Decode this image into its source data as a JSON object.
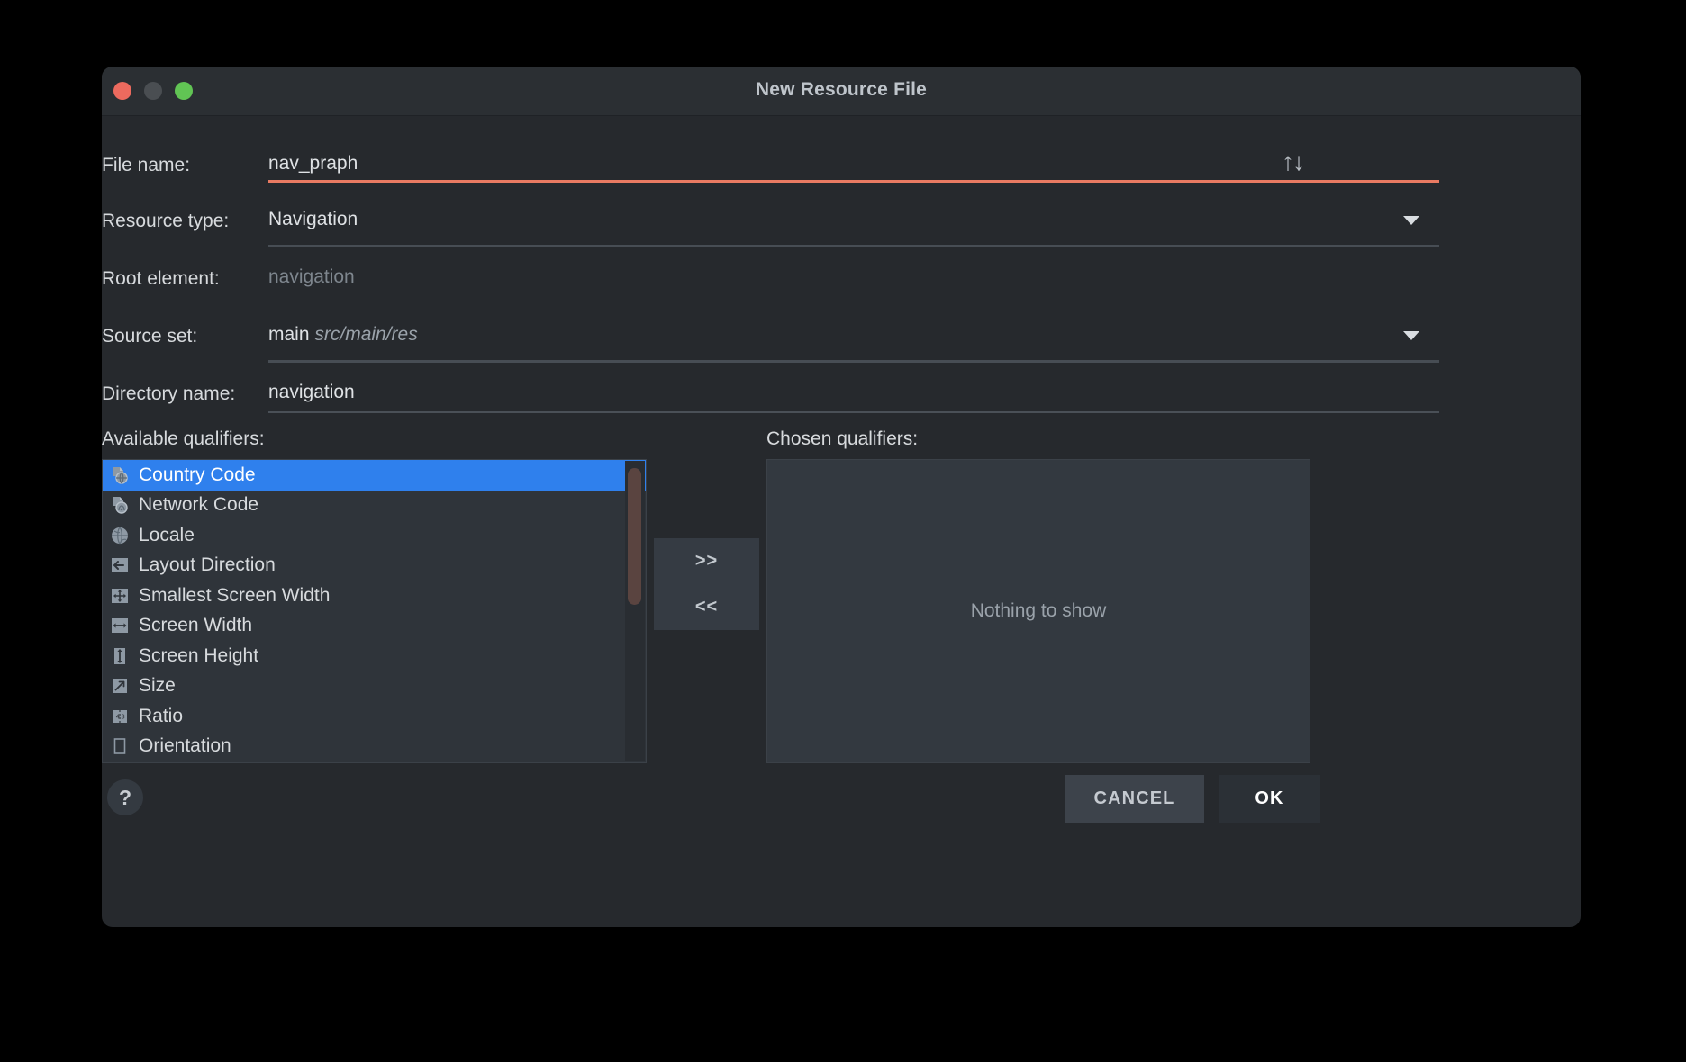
{
  "window": {
    "title": "New Resource File",
    "traffic_lights": [
      "close",
      "minimize",
      "maximize"
    ]
  },
  "form": {
    "file_name": {
      "label": "File name:",
      "value": "nav_praph",
      "accent_color": "#e87a62"
    },
    "resource_type": {
      "label": "Resource type:",
      "value": "Navigation"
    },
    "root_element": {
      "label": "Root element:",
      "value": "navigation",
      "is_placeholder": true
    },
    "source_set": {
      "label": "Source set:",
      "value": "main",
      "path": "src/main/res"
    },
    "directory_name": {
      "label": "Directory name:",
      "value": "navigation"
    },
    "sort_icon": "↑↓"
  },
  "qualifiers": {
    "available_label": "Available qualifiers:",
    "chosen_label": "Chosen qualifiers:",
    "available_items": [
      {
        "label": "Country Code",
        "icon": "country-code-icon",
        "selected": true
      },
      {
        "label": "Network Code",
        "icon": "network-code-icon",
        "selected": false
      },
      {
        "label": "Locale",
        "icon": "locale-globe-icon",
        "selected": false
      },
      {
        "label": "Layout Direction",
        "icon": "layout-direction-icon",
        "selected": false
      },
      {
        "label": "Smallest Screen Width",
        "icon": "smallest-screen-width-icon",
        "selected": false
      },
      {
        "label": "Screen Width",
        "icon": "screen-width-icon",
        "selected": false
      },
      {
        "label": "Screen Height",
        "icon": "screen-height-icon",
        "selected": false
      },
      {
        "label": "Size",
        "icon": "size-icon",
        "selected": false
      },
      {
        "label": "Ratio",
        "icon": "ratio-icon",
        "selected": false
      },
      {
        "label": "Orientation",
        "icon": "orientation-icon",
        "selected": false
      }
    ],
    "chosen_empty_text": "Nothing to show",
    "add_button": ">>",
    "remove_button": "<<",
    "selection_color": "#2f80ed",
    "scrollbar_color": "#5a4440"
  },
  "footer": {
    "help_label": "?",
    "cancel_label": "CANCEL",
    "ok_label": "OK"
  }
}
